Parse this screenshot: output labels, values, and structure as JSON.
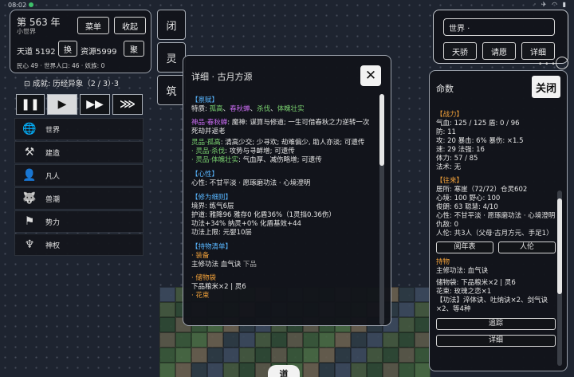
{
  "status_bar": {
    "time": "08:02",
    "icons": "· ✈ ◠ ▮"
  },
  "left_panel": {
    "year": "第 563 年",
    "world_type": "小世界",
    "menu_label": "菜单",
    "collapse_label": "收起",
    "tiandao_label": "天道 5192",
    "swap_label": "换",
    "resource_label": "资源5999",
    "gather_label": "聚",
    "stats_line": "民心 49 · 世界人口: 46 · 妖族: 0",
    "achievement": "成就: 历经异象（2 / 3）·3"
  },
  "controls": [
    "❚❚",
    "▶",
    "▶▶",
    "⋙"
  ],
  "side_menu": [
    {
      "icon": "globe-icon",
      "glyph": "🌐",
      "label": "世界"
    },
    {
      "icon": "hammer-icon",
      "glyph": "⚒",
      "label": "建造"
    },
    {
      "icon": "person-icon",
      "glyph": "👤",
      "label": "凡人"
    },
    {
      "icon": "beast-icon",
      "glyph": "🐺",
      "label": "兽潮"
    },
    {
      "icon": "faction-icon",
      "glyph": "⚑",
      "label": "势力"
    },
    {
      "icon": "divine-icon",
      "glyph": "♆",
      "label": "神权"
    }
  ],
  "vertical_tabs": [
    "闭",
    "灵",
    "筑"
  ],
  "detail": {
    "title": "详细 · 古月方源",
    "close": "✕",
    "sec_talent": "【禀赋】",
    "traits_prefix": "特质: ",
    "traits": [
      "孤高",
      "春秋蝉",
      "杀伐",
      "体魄壮实"
    ],
    "divine_name": "神品·春秋蝉",
    "divine_desc": ": 魔神: 谋算与修道; 一生可借春秋之力逆转一次死劫并返老",
    "spirit1_name": "灵品·孤高",
    "spirit1_desc": ": 清高少交; 少寻欢; 劫难偏少, 助人亦淡; 可遗传",
    "spirit2_name": "· 灵品·杀伐",
    "spirit2_desc": ": 攻势与寻衅增; 可遗传",
    "spirit3_name": "· 灵品·体魄壮实",
    "spirit3_desc": ": 气血厚、减伤略增; 可遗传",
    "sec_heart": "【心性】",
    "heart_line": "心性: 不甘平淡 · 愿琢磨功法 · 心境澄明",
    "sec_cultivation": "【修为细则】",
    "realm": "境界: 练气6层",
    "protect": "护道: 雅降96  雅存0  化盾36%（1灵挡0.36伤）",
    "power": "功法+34%   纳灵+0%   化盾基效+44",
    "limit": "功法上限: 元婴10层",
    "sec_items": "【持物清单】",
    "equip_head": "· 装备",
    "equip_line1": "主修功法  血气诀",
    "equip_line1_grade": " 下品",
    "storage_head": "· 储物袋",
    "storage_line": "下品粮米×2 | 灵6",
    "flower_head": "· 花束"
  },
  "right_top": {
    "world_input": "世界 ·",
    "buttons": [
      "天骄",
      "请愿",
      "详细"
    ]
  },
  "right_main": {
    "title": "命数",
    "close": "关闭",
    "sec_battle": "【战力】",
    "battle_lines": [
      "气血: 125 / 125  盾: 0 / 96",
      "防: 11",
      "攻: 20  暴击: 6%  暴伤: ×1.5",
      "速: 29  法强: 16",
      "体力: 57 / 85",
      "法术: 无"
    ],
    "sec_future": "【往来】",
    "future_lines": [
      "居所: 寒崖（72/72）仓灵602",
      "心境: 100  野心: 100",
      "俊朗: 63  聪慧: 4/10",
      "心性: 不甘平淡 · 愿琢磨功法 · 心境澄明",
      "仇敌: 0",
      "人伦: 共3人（父母·古月方元、手足1）"
    ],
    "btn_annals": "阅年表",
    "btn_relations": "人伦",
    "items_head": "持物",
    "items_lines": [
      "主修功法: 血气诀",
      "储物袋: 下品粮米×2 | 灵6",
      "花束: 玫瑰之恋×1",
      "【功法】淬体诀、吐纳诀×2、剑气诀×2、等4种"
    ],
    "btn_track": "追踪",
    "btn_detail": "详细"
  },
  "bottom_badge": "道",
  "colors": {
    "accent_blue": "#58b6ff",
    "green": "#79d16f",
    "purple": "#c86bf0",
    "orange": "#f3a23a"
  }
}
